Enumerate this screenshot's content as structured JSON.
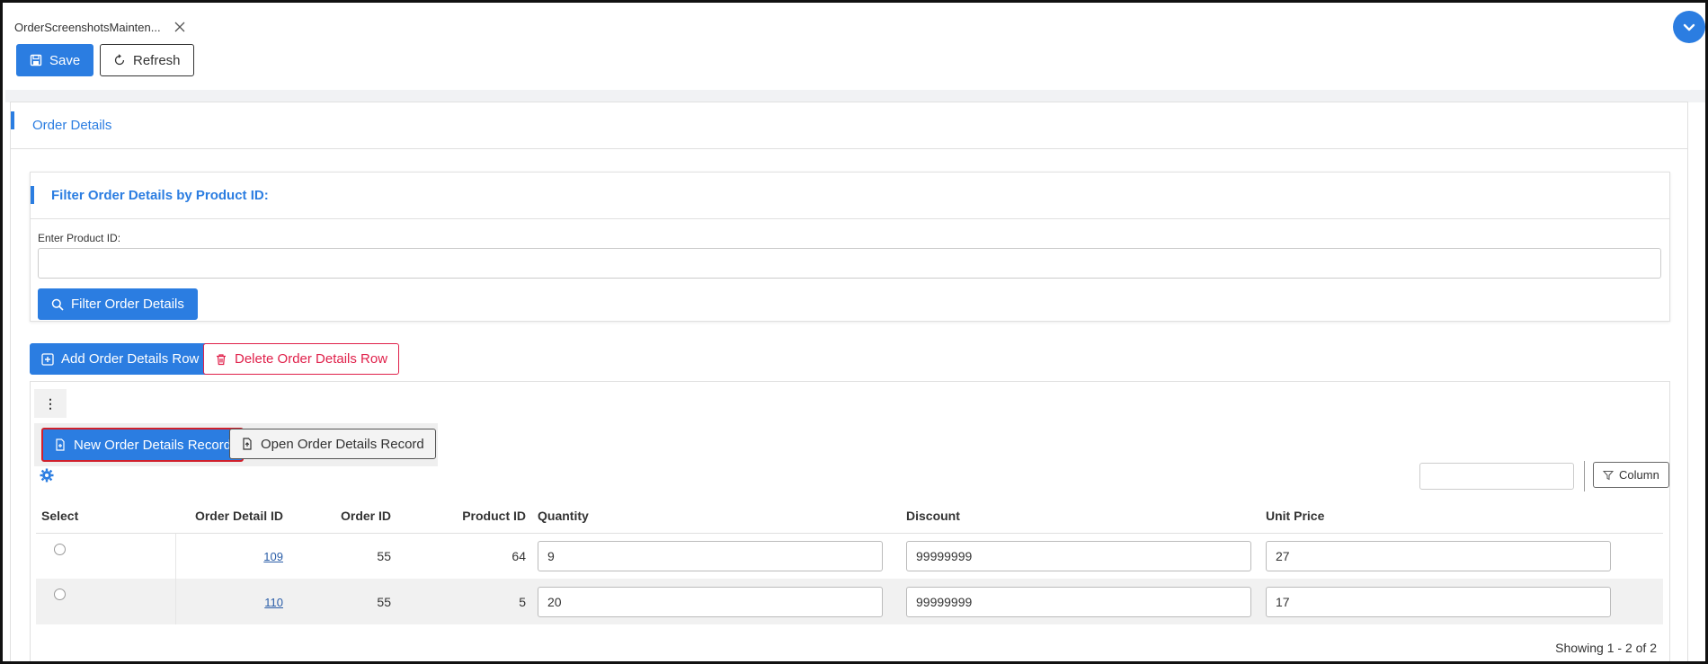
{
  "tab": {
    "title": "OrderScreenshotsMainten..."
  },
  "toolbar": {
    "save_label": "Save",
    "refresh_label": "Refresh"
  },
  "panel": {
    "title": "Order Details"
  },
  "filter": {
    "title": "Filter Order Details by Product ID:",
    "label": "Enter Product ID:",
    "value": "",
    "button_label": "Filter Order Details"
  },
  "actions": {
    "add_label": "Add Order Details Row",
    "delete_label": "Delete Order Details Row"
  },
  "records": {
    "kebab": "⋮",
    "new_label": "New Order Details Record",
    "open_label": "Open Order Details Record"
  },
  "grid": {
    "search_value": "",
    "column_label": "Column",
    "headers": {
      "select": "Select",
      "order_detail_id": "Order Detail ID",
      "order_id": "Order ID",
      "product_id": "Product ID",
      "quantity": "Quantity",
      "discount": "Discount",
      "unit_price": "Unit Price"
    },
    "rows": [
      {
        "order_detail_id": "109",
        "order_id": "55",
        "product_id": "64",
        "quantity": "9",
        "discount": "99999999",
        "unit_price": "27"
      },
      {
        "order_detail_id": "110",
        "order_id": "55",
        "product_id": "5",
        "quantity": "20",
        "discount": "99999999",
        "unit_price": "17"
      }
    ],
    "footer": "Showing 1 - 2 of 2"
  },
  "colors": {
    "primary": "#2b7de1",
    "danger": "#e0204a",
    "highlight": "#d0202c"
  }
}
